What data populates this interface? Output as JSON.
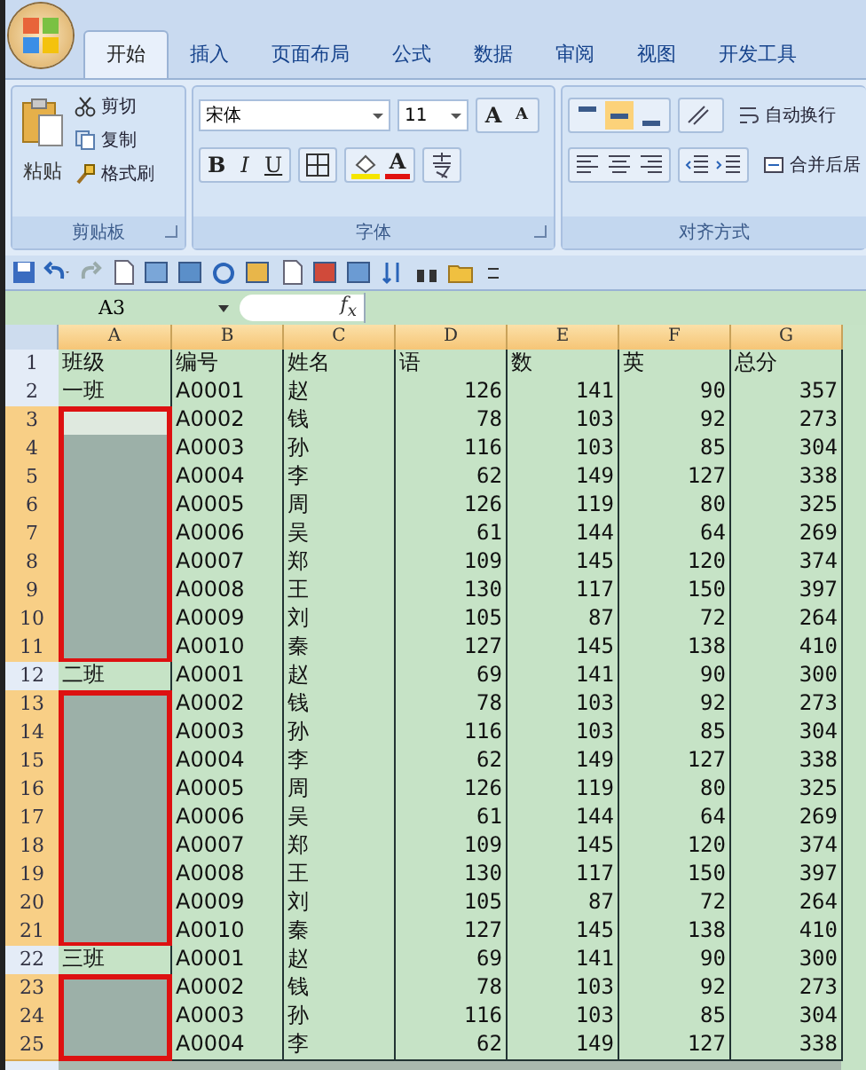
{
  "tabs": [
    {
      "label": "开始",
      "selected": true
    },
    {
      "label": "插入",
      "selected": false
    },
    {
      "label": "页面布局",
      "selected": false
    },
    {
      "label": "公式",
      "selected": false
    },
    {
      "label": "数据",
      "selected": false
    },
    {
      "label": "审阅",
      "selected": false
    },
    {
      "label": "视图",
      "selected": false
    },
    {
      "label": "开发工具",
      "selected": false
    }
  ],
  "clipboard": {
    "title": "剪贴板",
    "paste": "粘贴",
    "cut": "剪切",
    "copy": "复制",
    "format_painter": "格式刷"
  },
  "font": {
    "title": "字体",
    "name": "宋体",
    "size": "11",
    "grow": "A",
    "shrink": "A",
    "bold": "B",
    "italic": "I",
    "underline": "U",
    "font_color": "A"
  },
  "alignment": {
    "title": "对齐方式",
    "vertical": [
      {
        "selected": false
      },
      {
        "selected": true
      },
      {
        "selected": false
      }
    ],
    "wrap_text": "自动换行",
    "merge": "合并后居"
  },
  "name_box": "A3",
  "fx": "f$_{x}$",
  "columns": [
    "A",
    "B",
    "C",
    "D",
    "E",
    "F",
    "G"
  ],
  "rows": [
    {
      "num": "1",
      "kind": "header",
      "selected": false,
      "active": false,
      "a": "班级",
      "cells": [
        "编号",
        "姓名",
        "语",
        "数",
        "英",
        "总分"
      ]
    },
    {
      "num": "2",
      "kind": "data",
      "selected": false,
      "active": false,
      "a": "一班",
      "cells": [
        "A0001",
        "赵",
        "126",
        "141",
        "90",
        "357"
      ]
    },
    {
      "num": "3",
      "kind": "data",
      "selected": true,
      "active": true,
      "cells": [
        "A0002",
        "钱",
        "78",
        "103",
        "92",
        "273"
      ]
    },
    {
      "num": "4",
      "kind": "data",
      "selected": true,
      "active": false,
      "cells": [
        "A0003",
        "孙",
        "116",
        "103",
        "85",
        "304"
      ]
    },
    {
      "num": "5",
      "kind": "data",
      "selected": true,
      "active": false,
      "cells": [
        "A0004",
        "李",
        "62",
        "149",
        "127",
        "338"
      ]
    },
    {
      "num": "6",
      "kind": "data",
      "selected": true,
      "active": false,
      "cells": [
        "A0005",
        "周",
        "126",
        "119",
        "80",
        "325"
      ]
    },
    {
      "num": "7",
      "kind": "data",
      "selected": true,
      "active": false,
      "cells": [
        "A0006",
        "吴",
        "61",
        "144",
        "64",
        "269"
      ]
    },
    {
      "num": "8",
      "kind": "data",
      "selected": true,
      "active": false,
      "cells": [
        "A0007",
        "郑",
        "109",
        "145",
        "120",
        "374"
      ]
    },
    {
      "num": "9",
      "kind": "data",
      "selected": true,
      "active": false,
      "cells": [
        "A0008",
        "王",
        "130",
        "117",
        "150",
        "397"
      ]
    },
    {
      "num": "10",
      "kind": "data",
      "selected": true,
      "active": false,
      "cells": [
        "A0009",
        "刘",
        "105",
        "87",
        "72",
        "264"
      ]
    },
    {
      "num": "11",
      "kind": "data",
      "selected": true,
      "active": false,
      "cells": [
        "A0010",
        "秦",
        "127",
        "145",
        "138",
        "410"
      ]
    },
    {
      "num": "12",
      "kind": "data",
      "selected": false,
      "active": false,
      "a": "二班",
      "cells": [
        "A0001",
        "赵",
        "69",
        "141",
        "90",
        "300"
      ]
    },
    {
      "num": "13",
      "kind": "data",
      "selected": true,
      "active": false,
      "cells": [
        "A0002",
        "钱",
        "78",
        "103",
        "92",
        "273"
      ]
    },
    {
      "num": "14",
      "kind": "data",
      "selected": true,
      "active": false,
      "cells": [
        "A0003",
        "孙",
        "116",
        "103",
        "85",
        "304"
      ]
    },
    {
      "num": "15",
      "kind": "data",
      "selected": true,
      "active": false,
      "cells": [
        "A0004",
        "李",
        "62",
        "149",
        "127",
        "338"
      ]
    },
    {
      "num": "16",
      "kind": "data",
      "selected": true,
      "active": false,
      "cells": [
        "A0005",
        "周",
        "126",
        "119",
        "80",
        "325"
      ]
    },
    {
      "num": "17",
      "kind": "data",
      "selected": true,
      "active": false,
      "cells": [
        "A0006",
        "吴",
        "61",
        "144",
        "64",
        "269"
      ]
    },
    {
      "num": "18",
      "kind": "data",
      "selected": true,
      "active": false,
      "cells": [
        "A0007",
        "郑",
        "109",
        "145",
        "120",
        "374"
      ]
    },
    {
      "num": "19",
      "kind": "data",
      "selected": true,
      "active": false,
      "cells": [
        "A0008",
        "王",
        "130",
        "117",
        "150",
        "397"
      ]
    },
    {
      "num": "20",
      "kind": "data",
      "selected": true,
      "active": false,
      "cells": [
        "A0009",
        "刘",
        "105",
        "87",
        "72",
        "264"
      ]
    },
    {
      "num": "21",
      "kind": "data",
      "selected": true,
      "active": false,
      "cells": [
        "A0010",
        "秦",
        "127",
        "145",
        "138",
        "410"
      ]
    },
    {
      "num": "22",
      "kind": "data",
      "selected": false,
      "active": false,
      "a": "三班",
      "cells": [
        "A0001",
        "赵",
        "69",
        "141",
        "90",
        "300"
      ]
    },
    {
      "num": "23",
      "kind": "data",
      "selected": true,
      "active": false,
      "cells": [
        "A0002",
        "钱",
        "78",
        "103",
        "92",
        "273"
      ]
    },
    {
      "num": "24",
      "kind": "data",
      "selected": true,
      "active": false,
      "cells": [
        "A0003",
        "孙",
        "116",
        "103",
        "85",
        "304"
      ]
    },
    {
      "num": "25",
      "kind": "data",
      "selected": true,
      "active": false,
      "cells": [
        "A0004",
        "李",
        "62",
        "149",
        "127",
        "338"
      ]
    }
  ]
}
